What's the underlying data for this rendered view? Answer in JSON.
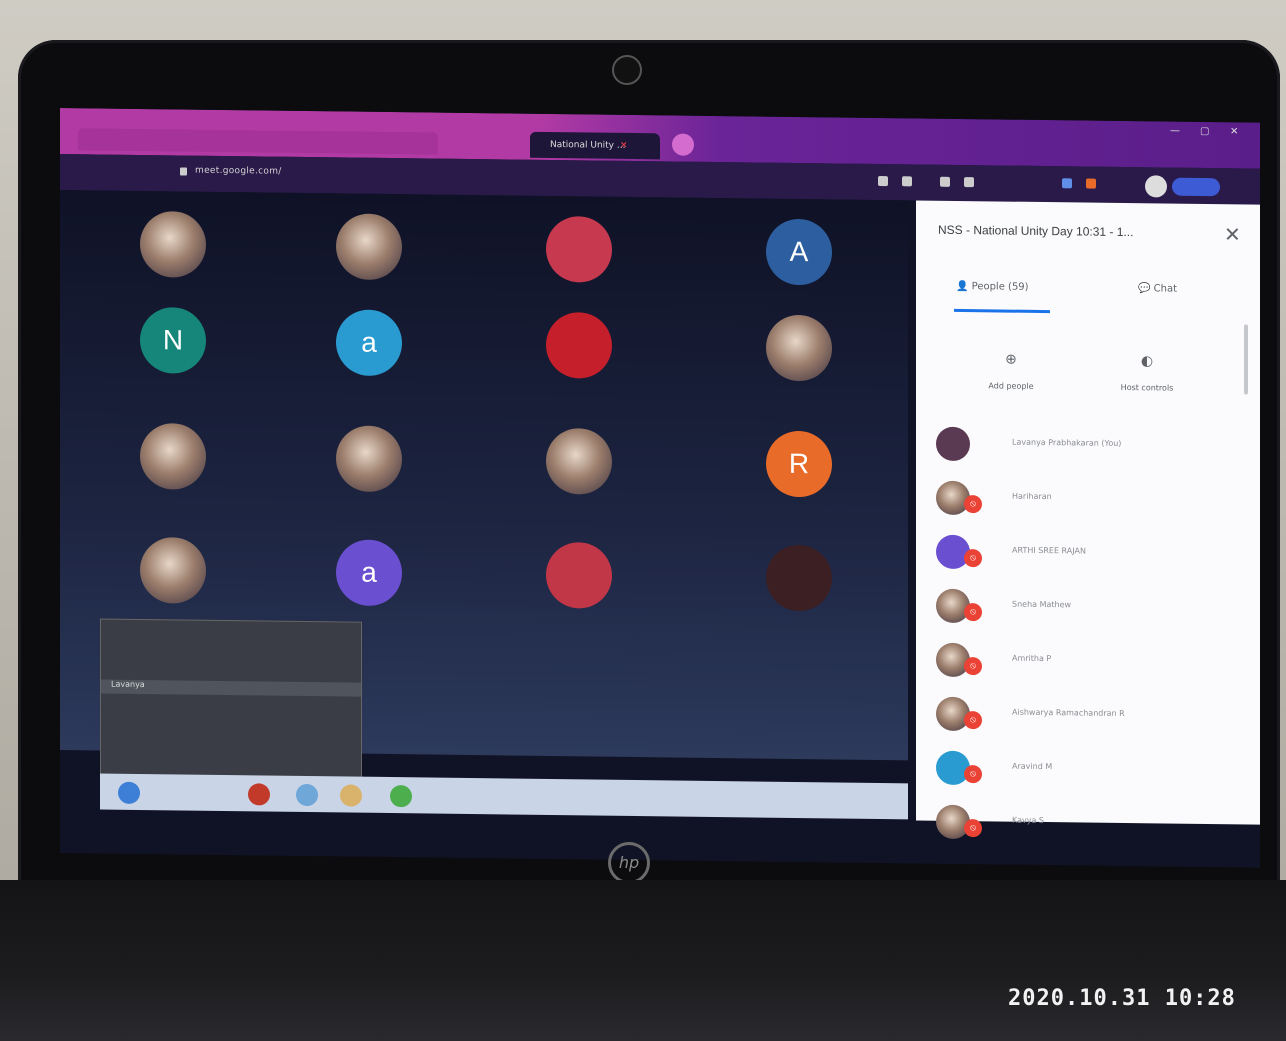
{
  "browser": {
    "tab_title": "National Unity ...",
    "url": "meet.google.com/"
  },
  "grid": {
    "tiles": [
      {
        "label": "",
        "color": "photo",
        "icon": "photo-avatar"
      },
      {
        "label": "",
        "color": "photo",
        "icon": "photo-avatar"
      },
      {
        "label": "",
        "color": "#c6394f",
        "icon": "flower-avatar"
      },
      {
        "label": "A",
        "color": "#2d5fa0"
      },
      {
        "label": "N",
        "color": "#16857a"
      },
      {
        "label": "a",
        "color": "#2a9bd0"
      },
      {
        "label": "",
        "color": "#c51f2c",
        "icon": "rose-avatar"
      },
      {
        "label": "",
        "color": "photo",
        "icon": "photo-avatar"
      },
      {
        "label": "",
        "color": "photo",
        "icon": "photo-avatar"
      },
      {
        "label": "",
        "color": "photo",
        "icon": "photo-avatar"
      },
      {
        "label": "",
        "color": "photo",
        "icon": "photo-avatar"
      },
      {
        "label": "R",
        "color": "#e86b2a"
      },
      {
        "label": "",
        "color": "photo",
        "icon": "photo-avatar"
      },
      {
        "label": "a",
        "color": "#6a4fd0"
      },
      {
        "label": "",
        "color": "#c23748",
        "icon": "flower-avatar"
      },
      {
        "label": "",
        "color": "#3b1f22",
        "icon": "photo-avatar"
      }
    ]
  },
  "panel": {
    "title": "NSS - National Unity Day 10:31 - 1...",
    "tab_people": "People (59)",
    "tab_chat": "Chat",
    "action_add": "Add people",
    "action_host": "Host controls",
    "people": [
      {
        "name": "Lavanya Prabhakaran (You)",
        "color": "#5a3a52",
        "muted": false
      },
      {
        "name": "Hariharan",
        "color": "photo",
        "muted": true
      },
      {
        "name": "ARTHI SREE RAJAN",
        "color": "#6a4fd0",
        "muted": true
      },
      {
        "name": "Sneha Mathew",
        "color": "photo",
        "muted": true
      },
      {
        "name": "Amritha P",
        "color": "photo",
        "muted": true
      },
      {
        "name": "Aishwarya Ramachandran R",
        "color": "photo",
        "muted": true
      },
      {
        "name": "Aravind M",
        "color": "#2a9bd0",
        "muted": true
      },
      {
        "name": "Kavya S",
        "color": "photo",
        "muted": true
      }
    ]
  },
  "self_view": {
    "name": "Lavanya"
  },
  "photo_timestamp": "2020.10.31 10:28",
  "colors": {
    "accent": "#1a73e8",
    "mute_badge": "#ea4335",
    "tab_bar": "#b23aa5"
  }
}
